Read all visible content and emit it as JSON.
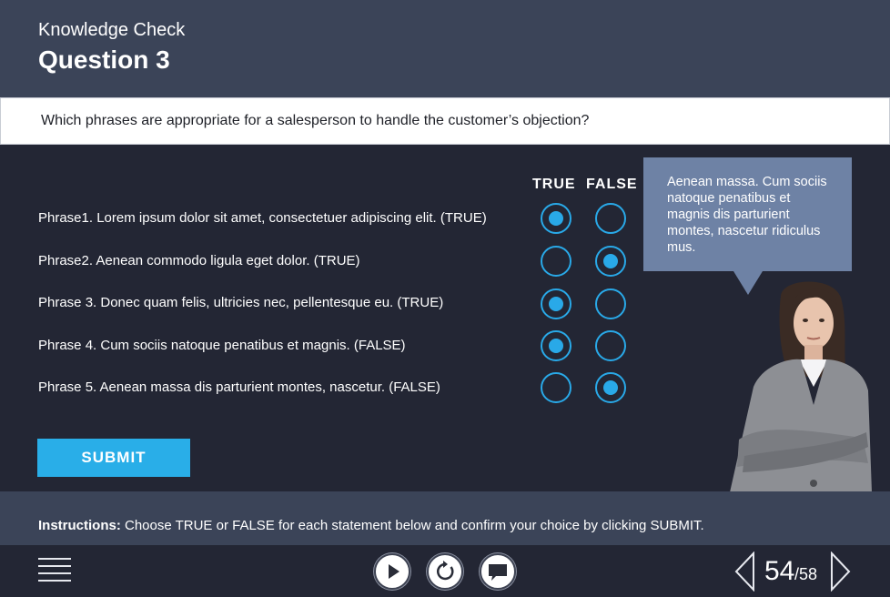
{
  "header": {
    "subtitle": "Knowledge Check",
    "title": "Question 3"
  },
  "question": "Which phrases are appropriate for a salesperson to handle the customer’s objection?",
  "columns": {
    "true_label": "TRUE",
    "false_label": "FALSE"
  },
  "rows": [
    {
      "phrase": "Phrase1. Lorem ipsum dolor sit amet, consectetuer adipiscing elit. (TRUE)",
      "selected": "true"
    },
    {
      "phrase": "Phrase2. Aenean commodo ligula eget dolor. (TRUE)",
      "selected": "false"
    },
    {
      "phrase": "Phrase 3. Donec quam felis, ultricies nec, pellentesque eu. (TRUE)",
      "selected": "true"
    },
    {
      "phrase": "Phrase 4. Cum sociis natoque penatibus et magnis. (FALSE)",
      "selected": "true"
    },
    {
      "phrase": "Phrase 5. Aenean massa dis parturient montes, nascetur. (FALSE)",
      "selected": "false"
    }
  ],
  "submit_label": "SUBMIT",
  "bubble_text": "Aenean massa. Cum sociis natoque penatibus et magnis dis parturient montes, nascetur ridiculus mus.",
  "instructions": {
    "label": "Instructions:",
    "text": " Choose TRUE or FALSE for each statement below and confirm your choice by clicking SUBMIT."
  },
  "pagination": {
    "current": "54",
    "total": "/58"
  },
  "icons": {
    "menu": "hamburger-menu-icon",
    "play": "play-icon",
    "replay": "replay-icon",
    "comment": "comment-icon",
    "prev": "chevron-left-icon",
    "next": "chevron-right-icon"
  },
  "colors": {
    "accent": "#29aee8",
    "header_bg": "#3b4458",
    "main_bg": "#232634",
    "bubble_bg": "#6e82a5"
  }
}
